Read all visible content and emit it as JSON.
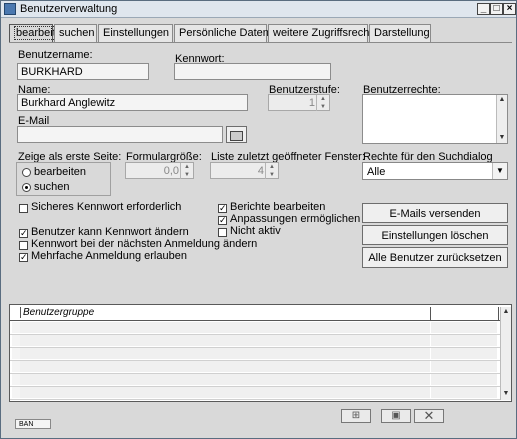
{
  "window": {
    "title": "Benutzerverwaltung"
  },
  "tabs": [
    {
      "label": "bearbeiten",
      "active": true
    },
    {
      "label": "suchen"
    },
    {
      "label": "Einstellungen"
    },
    {
      "label": "Persönliche Daten"
    },
    {
      "label": "weitere Zugriffsrechte"
    },
    {
      "label": "Darstellung"
    }
  ],
  "form": {
    "username_label": "Benutzername:",
    "username_value": "BURKHARD",
    "password_label": "Kennwort:",
    "password_value": "",
    "name_label": "Name:",
    "name_value": "Burkhard Anglewitz",
    "level_label": "Benutzerstufe:",
    "level_value": "1",
    "rights_label": "Benutzerrechte:",
    "email_label": "E-Mail",
    "email_value": "",
    "first_page_label": "Zeige als erste Seite:",
    "first_page_options": [
      "bearbeiten",
      "suchen"
    ],
    "first_page_selected": "suchen",
    "form_size_label": "Formulargröße:",
    "form_size_value": "0,0",
    "list_label": "Liste zuletzt geöffneter Fenster:",
    "list_value": "4",
    "search_rights_label": "Rechte für den Suchdialog",
    "search_rights_value": "Alle"
  },
  "checkboxes": {
    "secure_password": {
      "label": "Sicheres Kennwort erforderlich",
      "checked": false
    },
    "user_can_change": {
      "label": "Benutzer kann Kennwort ändern",
      "checked": true
    },
    "change_next_login": {
      "label": "Kennwort bei der nächsten Anmeldung ändern",
      "checked": false
    },
    "multi_login": {
      "label": "Mehrfache Anmeldung erlauben",
      "checked": true
    },
    "edit_reports": {
      "label": "Berichte bearbeiten",
      "checked": true
    },
    "allow_custom": {
      "label": "Anpassungen ermöglichen",
      "checked": true
    },
    "inactive": {
      "label": "Nicht aktiv",
      "checked": false
    }
  },
  "buttons": {
    "send_emails": "E-Mails versenden",
    "delete_settings": "Einstellungen löschen",
    "reset_all_users": "Alle Benutzer zurücksetzen"
  },
  "grid": {
    "column": "Benutzergruppe"
  },
  "status": {
    "code": "BAN"
  }
}
